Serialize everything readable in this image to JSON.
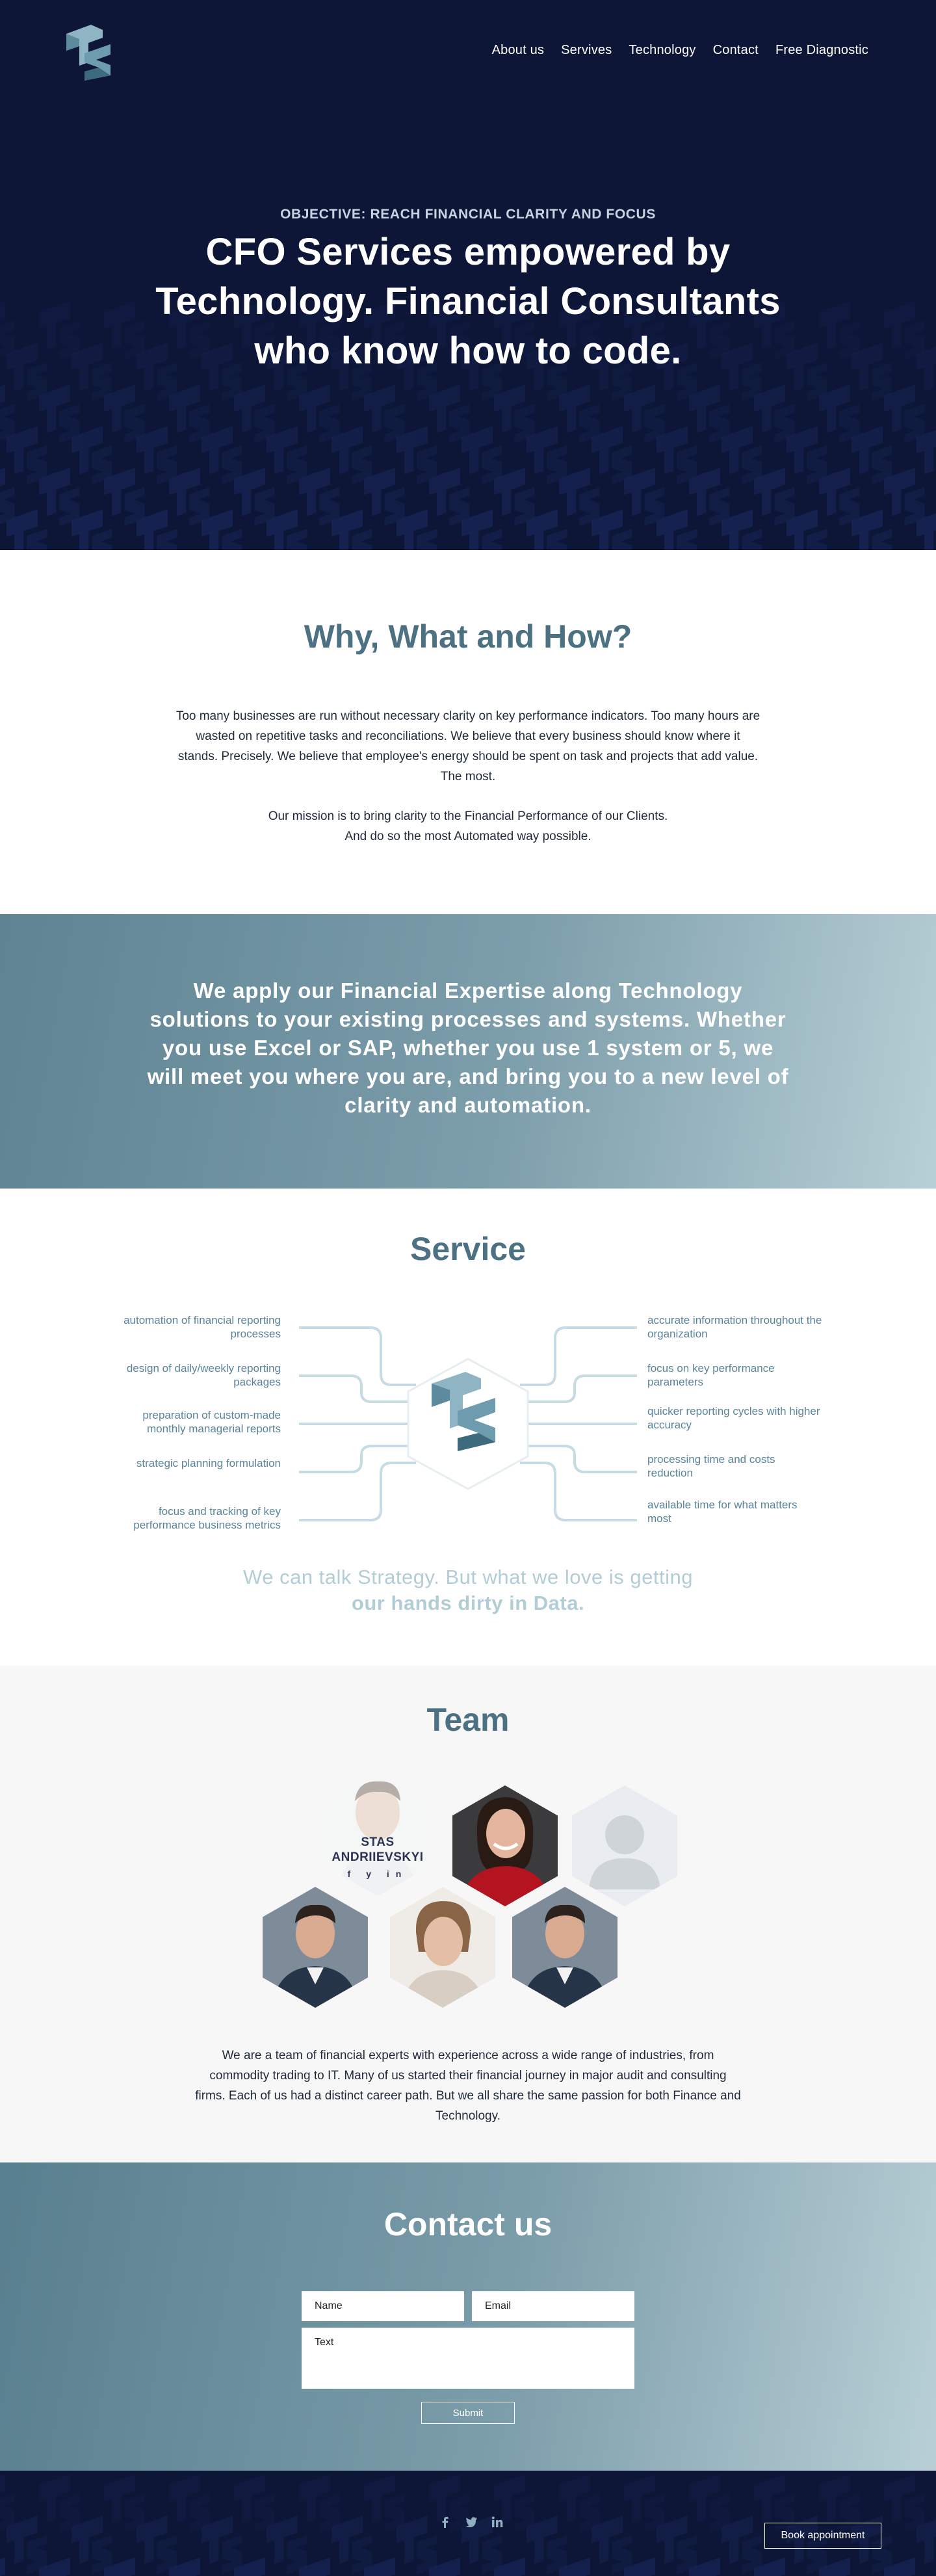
{
  "brand": {
    "logo": "ts-cube-logo",
    "accent": "#4c7182",
    "dark": "#0d1637",
    "light_accent": "#8fb0bf"
  },
  "nav": {
    "items": [
      "About us",
      "Servives",
      "Technology",
      "Contact",
      "Free Diagnostic"
    ]
  },
  "hero": {
    "eyebrow": "OBJECTIVE: REACH FINANCIAL CLARITY AND FOCUS",
    "title": "CFO Services empowered by Technology. Financial Consultants who know how to code."
  },
  "why": {
    "title": "Why, What and How?",
    "paragraph1": "Too many businesses are run without necessary clarity on key performance indicators. Too many hours are wasted on repetitive tasks and reconciliations. We believe that every business should know where it stands. Precisely. We believe that employee's energy should be spent on task and projects that add value. The most.",
    "paragraph2_line1": "Our mission is to bring clarity to the Financial Performance of our Clients.",
    "paragraph2_line2": "And do so the most Automated way possible."
  },
  "band": {
    "text": "We apply our Financial Expertise along Technology solutions to your existing processes and systems. Whether you use Excel or SAP, whether you use 1 system or 5, we will meet you where you are, and bring you to a new level of clarity and automation."
  },
  "service": {
    "title": "Service",
    "left_items": [
      "automation of financial reporting processes",
      "design of daily/weekly reporting packages",
      "preparation of custom-made monthly managerial reports",
      "strategic planning formulation",
      "focus and tracking of key performance business metrics"
    ],
    "right_items": [
      "accurate information throughout the organization",
      "focus on key performance parameters",
      "quicker reporting cycles with higher accuracy",
      "processing time and costs reduction",
      "available time for what matters most"
    ],
    "tagline_line1": "We can talk Strategy. But what we love is getting",
    "tagline_line2": "our hands dirty in Data."
  },
  "team": {
    "title": "Team",
    "featured_name": "STAS ANDRIIEVSKYI",
    "social": [
      "facebook-icon",
      "twitter-icon",
      "linkedin-icon"
    ],
    "social_glyphs": "f  y  in",
    "description": "We are a team of financial experts with experience across a wide range of industries, from commodity trading to IT. Many of us started their financial journey in major audit and consulting firms. Each of us had a distinct career path. But we all share the same passion for both Finance and Technology."
  },
  "contact": {
    "title": "Contact us",
    "name_placeholder": "Name",
    "email_placeholder": "Email",
    "text_placeholder": "Text",
    "submit_label": "Submit"
  },
  "footer": {
    "social": [
      "facebook-icon",
      "twitter-icon",
      "linkedin-icon"
    ],
    "book_label": "Book appointment"
  }
}
